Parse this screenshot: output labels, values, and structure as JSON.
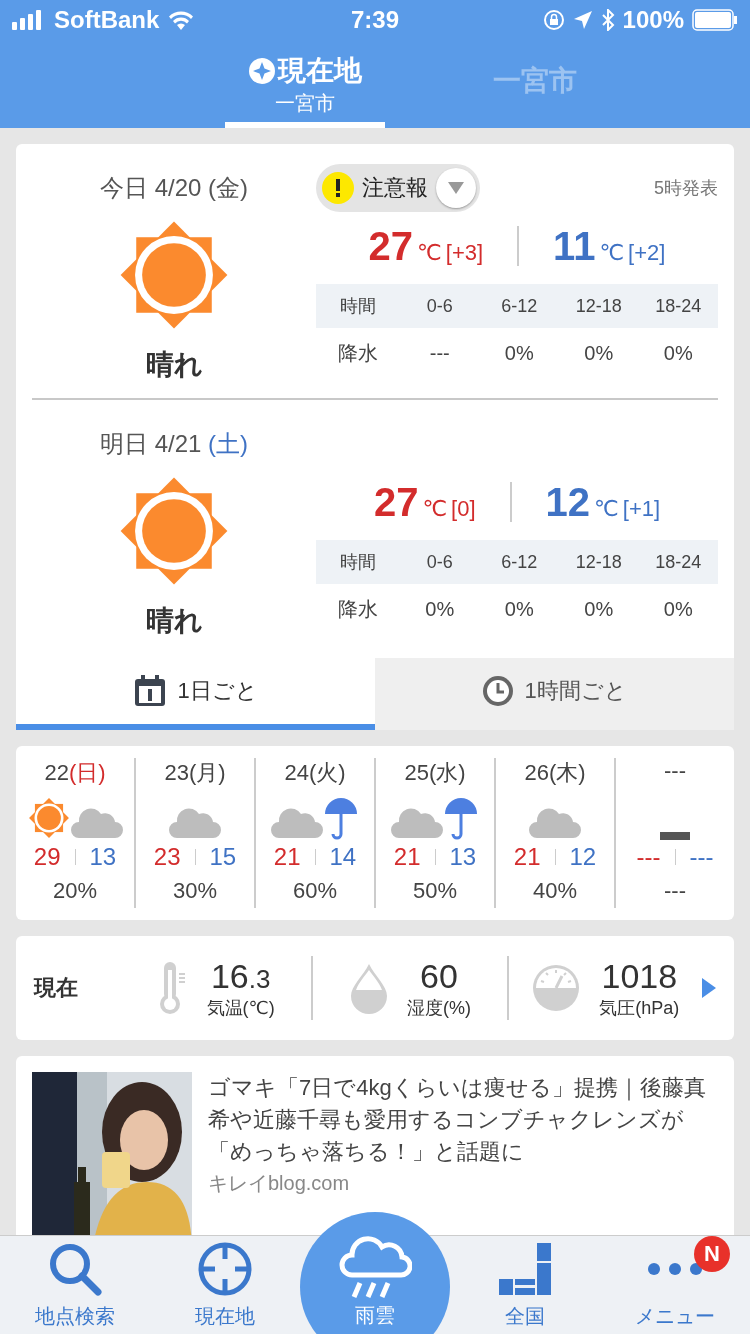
{
  "status_bar": {
    "carrier": "SoftBank",
    "time": "7:39",
    "battery": "100%"
  },
  "header_tabs": [
    {
      "label": "現在地",
      "sublabel": "一宮市",
      "kind": "location",
      "selected": true
    },
    {
      "label": "一宮市",
      "kind": "city",
      "selected": false
    }
  ],
  "days": [
    {
      "date_label": "今日",
      "date": "4/20",
      "weekday": {
        "text": "(金)",
        "kind": "weekday"
      },
      "warning": "注意報",
      "issued": "5時発表",
      "weather": "晴れ",
      "kind": "sunny",
      "high": "27",
      "high_diff": "[+3]",
      "low": "11",
      "low_diff": "[+2]",
      "unit": "℃",
      "table_header": [
        "時間",
        "0-6",
        "6-12",
        "12-18",
        "18-24"
      ],
      "table_row": [
        "降水",
        "---",
        "0%",
        "0%",
        "0%"
      ]
    },
    {
      "date_label": "明日",
      "date": "4/21",
      "weekday": {
        "text": "(土)",
        "kind": "saturday"
      },
      "weather": "晴れ",
      "kind": "sunny",
      "high": "27",
      "high_diff": "[0]",
      "low": "12",
      "low_diff": "[+1]",
      "unit": "℃",
      "table_header": [
        "時間",
        "0-6",
        "6-12",
        "12-18",
        "18-24"
      ],
      "table_row": [
        "降水",
        "0%",
        "0%",
        "0%",
        "0%"
      ]
    }
  ],
  "view_tabs": [
    {
      "label": "1日ごと",
      "kind": "daily",
      "selected": true
    },
    {
      "label": "1時間ごと",
      "kind": "hourly",
      "selected": false
    }
  ],
  "weekly": [
    {
      "date": "22",
      "weekday": {
        "text": "(日)",
        "kind": "sunday"
      },
      "icons": [
        {
          "kind": "sun"
        },
        {
          "kind": "cloud"
        }
      ],
      "high": "29",
      "low": "13",
      "precip": "20%"
    },
    {
      "date": "23",
      "weekday": {
        "text": "(月)",
        "kind": "weekday"
      },
      "icons": [
        {
          "kind": "cloud"
        }
      ],
      "high": "23",
      "low": "15",
      "precip": "30%"
    },
    {
      "date": "24",
      "weekday": {
        "text": "(火)",
        "kind": "weekday"
      },
      "icons": [
        {
          "kind": "cloud"
        },
        {
          "kind": "umbrella"
        }
      ],
      "high": "21",
      "low": "14",
      "precip": "60%"
    },
    {
      "date": "25",
      "weekday": {
        "text": "(水)",
        "kind": "weekday"
      },
      "icons": [
        {
          "kind": "cloud"
        },
        {
          "kind": "umbrella"
        }
      ],
      "high": "21",
      "low": "13",
      "precip": "50%"
    },
    {
      "date": "26",
      "weekday": {
        "text": "(木)",
        "kind": "weekday"
      },
      "icons": [
        {
          "kind": "cloud"
        }
      ],
      "high": "21",
      "low": "12",
      "precip": "40%"
    },
    {
      "date": "---",
      "icons": [
        {
          "kind": "dash"
        }
      ],
      "high": "---",
      "low": "---",
      "precip": "---"
    }
  ],
  "current": {
    "label": "現在",
    "items": [
      {
        "kind": "temperature",
        "value": "16",
        "value_small": ".3",
        "label": "気温(℃)"
      },
      {
        "kind": "humidity",
        "value": "60",
        "label": "湿度(%)"
      },
      {
        "kind": "pressure",
        "value": "1018",
        "label": "気圧(hPa)"
      }
    ]
  },
  "ad": {
    "kind": "picture",
    "title": "ゴマキ「7日で4kgくらいは痩せる」提携｜後藤真希や近藤千尋も愛用するコンブチャクレンズが「めっちゃ落ちる！」と話題に",
    "source": "キレイblog.com"
  },
  "bottom_nav": [
    {
      "label": "地点検索",
      "kind": "search",
      "selected": false
    },
    {
      "label": "現在地",
      "kind": "crosshair",
      "selected": false
    },
    {
      "label": "雨雲",
      "kind": "rain-cloud",
      "selected": true
    },
    {
      "label": "全国",
      "kind": "map",
      "selected": false
    },
    {
      "label": "メニュー",
      "kind": "dots",
      "badge": "N",
      "selected": false
    }
  ]
}
